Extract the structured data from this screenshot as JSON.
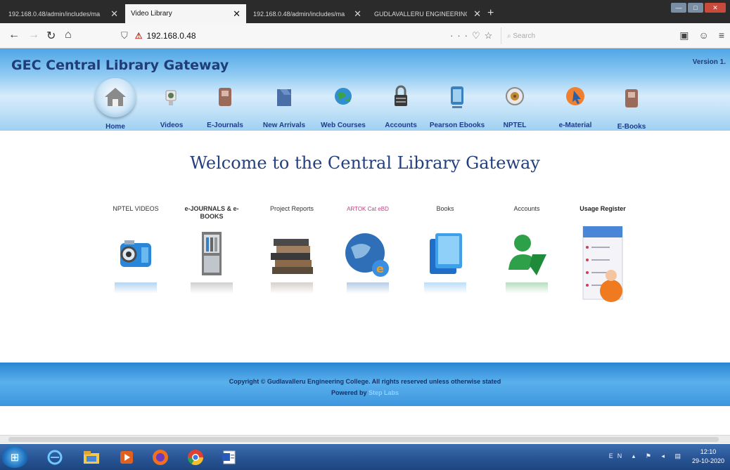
{
  "browser": {
    "tabs": [
      {
        "title": "192.168.0.48/admin/includes/ma",
        "active": false
      },
      {
        "title": "Video Library",
        "active": true
      },
      {
        "title": "192.168.0.48/admin/includes/ma",
        "active": false
      },
      {
        "title": "GUDLAVALLERU ENGINEERING C",
        "active": false
      }
    ],
    "url": "192.168.0.48",
    "search_placeholder": "Search"
  },
  "header": {
    "title": "GEC Central Library Gateway",
    "version": "Version 1.",
    "nav": [
      {
        "label": "Home",
        "icon": "home-icon",
        "active": true
      },
      {
        "label": "Videos",
        "icon": "video-camera-icon"
      },
      {
        "label": "E-Journals",
        "icon": "book-icon"
      },
      {
        "label": "New Arrivals",
        "icon": "new-arrivals-icon"
      },
      {
        "label": "Web Courses",
        "icon": "globe-icon"
      },
      {
        "label": "Accounts",
        "icon": "lock-icon"
      },
      {
        "label": "Pearson Ebooks",
        "icon": "tablet-icon"
      },
      {
        "label": "NPTEL",
        "icon": "nptel-icon"
      },
      {
        "label": "e-Material",
        "icon": "cursor-icon"
      },
      {
        "label": "E-Books",
        "icon": "ebook-icon"
      }
    ]
  },
  "main": {
    "welcome": "Welcome to the Central Library Gateway",
    "tiles": [
      {
        "label": "NPTEL VIDEOS",
        "icon": "video-camera-icon"
      },
      {
        "label": "e-JOURNALS & e-BOOKS",
        "icon": "bookshelf-icon"
      },
      {
        "label": "Project Reports",
        "icon": "books-stack-icon"
      },
      {
        "label": "ARTOK Cat eBD",
        "icon": "globe-icon"
      },
      {
        "label": "Books",
        "icon": "book-icon"
      },
      {
        "label": "Accounts",
        "icon": "user-icon"
      },
      {
        "label": "Usage Register",
        "icon": "register-icon"
      }
    ]
  },
  "footer": {
    "copyright": "Copyright © Gudlavalleru Engineering College. All rights reserved unless otherwise stated",
    "powered_prefix": "Powered by",
    "powered_brand": "Step Labs"
  },
  "taskbar": {
    "language": "EN",
    "time": "12:10",
    "date": "29-10-2020"
  },
  "colors": {
    "header_gradient_top": "#4fa6e6",
    "title_blue": "#1f3d78",
    "footer_blue": "#3d96de",
    "taskbar_blue": "#2a5697"
  }
}
